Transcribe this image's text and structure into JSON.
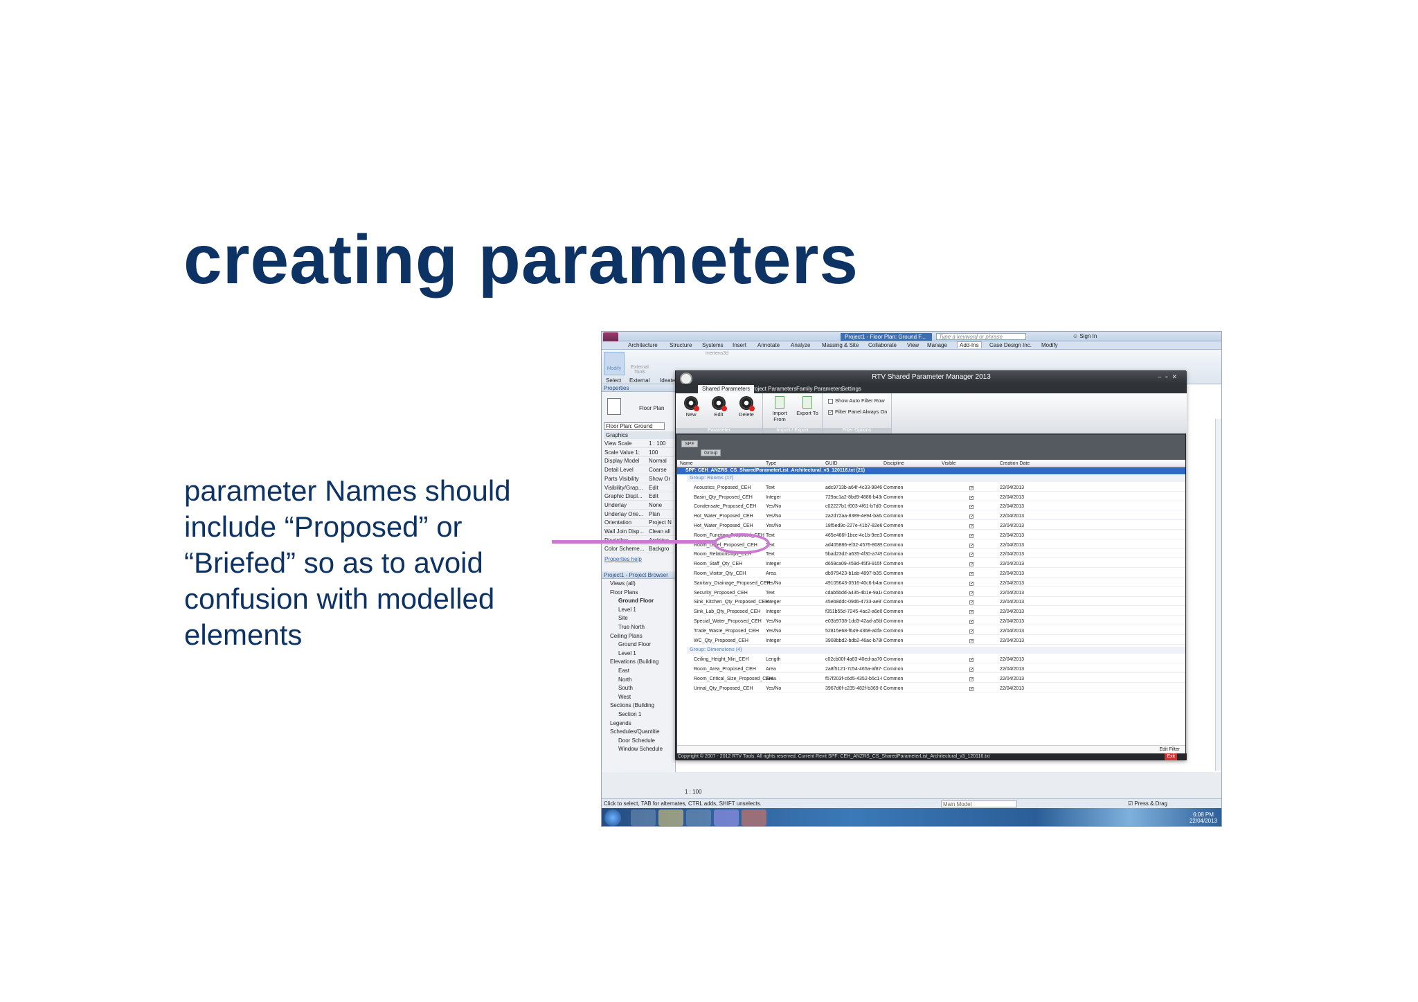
{
  "slide": {
    "title": "creating parameters",
    "body_lines": [
      "parameter Names should",
      "include “Proposed” or",
      "“Briefed” so as to avoid",
      "confusion with modelled",
      "elements"
    ]
  },
  "revit": {
    "window_title": "Project1 - Floor Plan: Ground F...",
    "search_placeholder": "Type a keyword or phrase",
    "sign_in": "Sign In",
    "tabs": [
      "Architecture",
      "Structure",
      "Systems",
      "Insert",
      "Annotate",
      "Analyze",
      "Massing & Site",
      "Collaborate",
      "View",
      "Manage",
      "Add-Ins",
      "Case Design Inc.",
      "Modify"
    ],
    "active_tab": "Add-Ins",
    "ribbon_labels": [
      "Select",
      "External",
      "Ideate"
    ],
    "ribbon_buttons": [
      "Modify",
      "External Tools",
      "mertens3d"
    ],
    "properties": {
      "title": "Properties",
      "type": "Floor Plan",
      "selector": "Floor Plan: Ground",
      "section": "Graphics",
      "rows": [
        [
          "View Scale",
          "1 : 100"
        ],
        [
          "Scale Value 1:",
          "100"
        ],
        [
          "Display Model",
          "Normal"
        ],
        [
          "Detail Level",
          "Coarse"
        ],
        [
          "Parts Visibility",
          "Show Or"
        ],
        [
          "Visibility/Grap...",
          "Edit"
        ],
        [
          "Graphic Displ...",
          "Edit"
        ],
        [
          "Underlay",
          "None"
        ],
        [
          "Underlay Orie...",
          "Plan"
        ],
        [
          "Orientation",
          "Project N"
        ],
        [
          "Wall Join Disp...",
          "Clean all"
        ],
        [
          "Discipline",
          "Architec"
        ],
        [
          "Color Scheme...",
          "Backgro"
        ]
      ],
      "help": "Properties help"
    },
    "browser": {
      "title": "Project1 - Project Browser",
      "items": [
        "Views (all)",
        "Floor Plans",
        "Ground Floor",
        "Level 1",
        "Site",
        "True North",
        "Ceiling Plans",
        "Ground Floor",
        "Level 1",
        "Elevations (Building",
        "East",
        "North",
        "South",
        "West",
        "Sections (Building",
        "Section 1",
        "Legends",
        "Schedules/Quantitie",
        "Door Schedule",
        "Window Schedule"
      ]
    },
    "view_scale": "1 : 100",
    "status_text": "Click to select, TAB for alternates, CTRL adds, SHIFT unselects.",
    "model_select": "Main Model",
    "press_drag": "Press & Drag",
    "clock_time": "6:08 PM",
    "clock_date": "22/04/2013"
  },
  "dialog": {
    "title": "RTV Shared Parameter Manager 2013",
    "tabs": [
      "Shared Parameters",
      "Project Parameters",
      "Family Parameters",
      "Settings"
    ],
    "groups": {
      "parameter": {
        "label": "Parameter",
        "buttons": [
          "New",
          "Edit",
          "Delete"
        ]
      },
      "import_export": {
        "label": "Import / Export",
        "buttons": [
          "Import From",
          "Export To"
        ]
      },
      "filter": {
        "label": "Filter Options",
        "options": [
          "Show Auto Filter Row",
          "Filter Panel Always On"
        ]
      }
    },
    "group_chips": [
      "SPF",
      "Group"
    ],
    "columns": [
      "Name",
      "Type",
      "GUID",
      "Discipline",
      "Visible",
      "Creation Date"
    ],
    "spf_row": "SPF: CEH_ANZRS_CS_SharedParameterList_Architectural_v3_120116.txt (21)",
    "sections": [
      {
        "label": "Group: Rooms (17)",
        "rows": [
          [
            "Acoustics_Proposed_CEH",
            "Text",
            "adc9713b-a64f-4c33-9846-8...",
            "Common",
            "22/04/2013"
          ],
          [
            "Basin_Qty_Proposed_CEH",
            "Integer",
            "729ac1a2-8bd9-4886-b43c-b...",
            "Common",
            "22/04/2013"
          ],
          [
            "Condensate_Proposed_CEH",
            "Yes/No",
            "c02227b1-f003-4f61-b7d0-1...",
            "Common",
            "22/04/2013"
          ],
          [
            "Hot_Water_Proposed_CEH",
            "Yes/No",
            "2a2d72aa-8389-4e94-ba64-...",
            "Common",
            "22/04/2013"
          ],
          [
            "Hot_Water_Proposed_CEH",
            "Yes/No",
            "18f5ed9c-227e-41b7-82e6-d...",
            "Common",
            "22/04/2013"
          ],
          [
            "Room_Function_Proposed_CEH",
            "Text",
            "465e466f-1bce-4c1b-9ee3-b...",
            "Common",
            "22/04/2013"
          ],
          [
            "Room_Level_Proposed_CEH",
            "Text",
            "ad405886-ef32-4576-8089-...",
            "Common",
            "22/04/2013"
          ],
          [
            "Room_Relationships_CEH",
            "Text",
            "5bad23d2-a635-4f30-a749-c...",
            "Common",
            "22/04/2013"
          ],
          [
            "Room_Staff_Qty_CEH",
            "Integer",
            "d659ca09-459d-45f3-915f-5...",
            "Common",
            "22/04/2013"
          ],
          [
            "Room_Visitor_Qty_CEH",
            "Area",
            "db979423-b1ab-4897-b353-...",
            "Common",
            "22/04/2013"
          ],
          [
            "Sanitary_Drainage_Proposed_CEH",
            "Yes/No",
            "49105643-0516-40c6-b4ae-...",
            "Common",
            "22/04/2013"
          ],
          [
            "Security_Proposed_CEH",
            "Text",
            "cdab5bdd-a435-4b1e-9a1e-c...",
            "Common",
            "22/04/2013"
          ],
          [
            "Sink_Kitchen_Qty_Proposed_CEH",
            "Integer",
            "45eb8ddc-09d6-4733-ae97-...",
            "Common",
            "22/04/2013"
          ],
          [
            "Sink_Lab_Qty_Proposed_CEH",
            "Integer",
            "f351b55d-7245-4ac2-a6e0-b...",
            "Common",
            "22/04/2013"
          ],
          [
            "Special_Water_Proposed_CEH",
            "Yes/No",
            "e03b9738-1dd3-42ad-a5bb-...",
            "Common",
            "22/04/2013"
          ],
          [
            "Trade_Waste_Proposed_CEH",
            "Yes/No",
            "52815e68-f649-4368-a0fa-4...",
            "Common",
            "22/04/2013"
          ],
          [
            "WC_Qty_Proposed_CEH",
            "Integer",
            "3908bbd2-bdb2-46ac-b786-...",
            "Common",
            "22/04/2013"
          ]
        ]
      },
      {
        "label": "Group: Dimensions (4)",
        "rows": [
          [
            "Ceiling_Height_Min_CEH",
            "Length",
            "c02cb00f-4a83-40ed-aa70-9...",
            "Common",
            "22/04/2013"
          ],
          [
            "Room_Area_Proposed_CEH",
            "Area",
            "2a8f5121-7c54-465a-af87-b...",
            "Common",
            "22/04/2013"
          ],
          [
            "Room_Critical_Size_Proposed_CEH",
            "Area",
            "f57f203f-c6d5-4352-b5c1-0...",
            "Common",
            "22/04/2013"
          ],
          [
            "Urinal_Qty_Proposed_CEH",
            "Yes/No",
            "3967d6f-c235-482f-b369-8...",
            "Common",
            "22/04/2013"
          ]
        ]
      }
    ],
    "edit_filter": "Edit Filter",
    "footer": "Copyright © 2007 - 2012 RTV Tools. All rights reserved.   Current Revit SPF: CEH_ANZRS_CS_SharedParameterList_Architectural_v3_120116.txt",
    "exit": "Exit"
  },
  "colors": {
    "title": "#0d3264",
    "callout": "#cc7ad0",
    "highlight": "#2f69c6"
  }
}
